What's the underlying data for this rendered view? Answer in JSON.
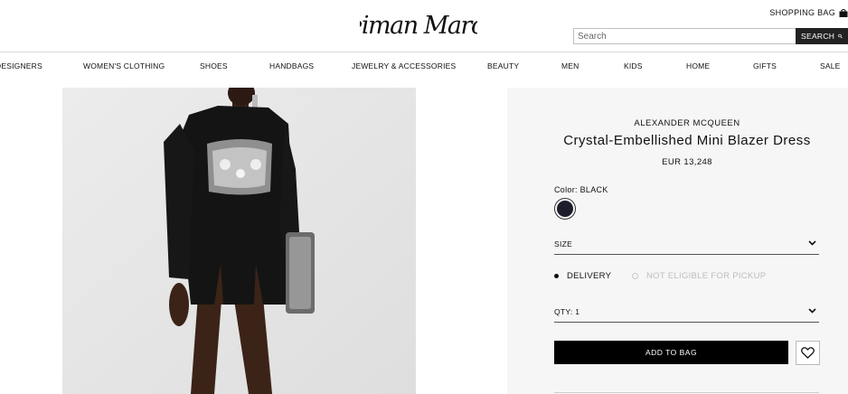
{
  "header": {
    "logo_text": "Neiman Marcus",
    "shopping_bag_label": "SHOPPING BAG",
    "search_placeholder": "Search",
    "search_button_label": "SEARCH"
  },
  "nav": {
    "items": [
      {
        "label": "DESIGNERS"
      },
      {
        "label": "WOMEN'S CLOTHING"
      },
      {
        "label": "SHOES"
      },
      {
        "label": "HANDBAGS"
      },
      {
        "label": "JEWELRY & ACCESSORIES"
      },
      {
        "label": "BEAUTY"
      },
      {
        "label": "MEN"
      },
      {
        "label": "KIDS"
      },
      {
        "label": "HOME"
      },
      {
        "label": "GIFTS"
      },
      {
        "label": "SALE"
      }
    ]
  },
  "product": {
    "brand": "ALEXANDER MCQUEEN",
    "title": "Crystal-Embellished Mini Blazer Dress",
    "price": "EUR 13,248",
    "color_label": "Color:",
    "color_value": "BLACK",
    "swatch_color": "#1c1d2a",
    "size_label": "SIZE",
    "delivery_label": "DELIVERY",
    "pickup_label": "NOT ELIGIBLE FOR PICKUP",
    "qty_label": "QTY:",
    "qty_value": "1",
    "add_to_bag_label": "ADD TO BAG"
  },
  "icons": {
    "search": "search-icon",
    "bag": "shopping-bag-icon",
    "chevron": "chevron-down-icon",
    "heart": "heart-icon"
  }
}
